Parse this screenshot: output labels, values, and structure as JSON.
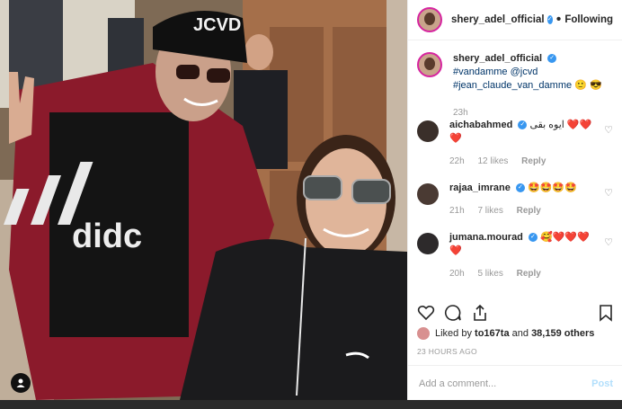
{
  "photo": {
    "shirt_text": "JCVD",
    "logo_text": "didc",
    "user_tag_icon": "person-icon"
  },
  "header": {
    "username": "shery_adel_official",
    "follow_label": "Following",
    "separator": "•"
  },
  "caption": {
    "username": "shery_adel_official",
    "parts": [
      "#vandamme",
      "@jcvd",
      "#jean_claude_van_damme",
      "🙂",
      "😎"
    ],
    "time": "23h"
  },
  "comments": [
    {
      "username": "aichabahmed",
      "text": "ايوه بقى ❤️❤️",
      "extra": "❤️",
      "time": "22h",
      "likes": "12 likes",
      "reply": "Reply",
      "avatar_color": "#3a2f2a"
    },
    {
      "username": "rajaa_imrane",
      "text": "🤩🤩🤩🤩",
      "extra": "",
      "time": "21h",
      "likes": "7 likes",
      "reply": "Reply",
      "avatar_color": "#4a3a33"
    },
    {
      "username": "jumana.mourad",
      "text": "🥰❤️❤️❤️",
      "extra": "❤️",
      "time": "20h",
      "likes": "5 likes",
      "reply": "Reply",
      "avatar_color": "#2d2a2b"
    }
  ],
  "likes": {
    "prefix": "Liked by",
    "user": "to167ta",
    "connector": "and",
    "count": "38,159 others"
  },
  "timestamp": "23 HOURS AGO",
  "add_comment": {
    "placeholder": "Add a comment...",
    "post_label": "Post"
  },
  "colors": {
    "verified": "#3897f0",
    "link": "#003569",
    "post_disabled": "#b2dffc",
    "jacket": "#8b1a2b"
  }
}
